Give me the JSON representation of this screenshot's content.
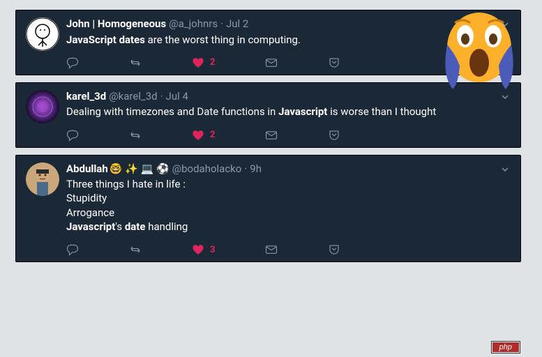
{
  "watermark": "php",
  "tweets": [
    {
      "name": "John | Homogeneous",
      "handle": "@a_johnrs",
      "time": "Jul 2",
      "body_html": "<b>JavaScript dates</b> are the worst thing in computing.",
      "like_count": "2",
      "name_emojis": ""
    },
    {
      "name": "karel_3d",
      "handle": "@karel_3d",
      "time": "Jul 4",
      "body_html": "Dealing with timezones and Date functions in <b>Javascript</b> is worse than I thought",
      "like_count": "2",
      "name_emojis": ""
    },
    {
      "name": "Abdullah",
      "handle": "@bodaholacko",
      "time": "9h",
      "body_html": "Three things I hate in life :<br>Stupidity<br>Arrogance<br><b>Javascript</b>'s <b>date</b> handling",
      "like_count": "3",
      "name_emojis": "🤓 ✨ 💻 ⚽"
    }
  ],
  "icons": {
    "reply": "reply-icon",
    "retweet": "retweet-icon",
    "like": "heart-icon",
    "dm": "envelope-icon",
    "pocket": "pocket-icon",
    "chevron": "chevron-down-icon"
  }
}
